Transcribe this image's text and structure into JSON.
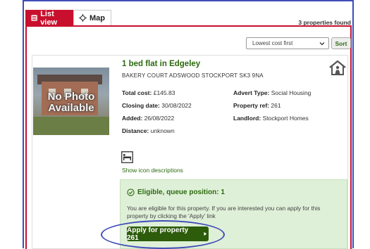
{
  "tabs": {
    "list_label": "List view",
    "map_label": "Map"
  },
  "results": {
    "count": "3 properties found"
  },
  "sort": {
    "selected": "Lowest cost first",
    "button_label": "Sort"
  },
  "property": {
    "title": "1 bed flat in Edgeley",
    "address": "BAKERY COURT ADSWOOD STOCKPORT SK3 9NA",
    "photo_text_line1": "No Photo",
    "photo_text_line2": "Available",
    "fields": {
      "total_cost_label": "Total cost:",
      "total_cost_value": "£145.83",
      "advert_type_label": "Advert Type:",
      "advert_type_value": "Social Housing",
      "closing_date_label": "Closing date:",
      "closing_date_value": "30/08/2022",
      "property_ref_label": "Property ref:",
      "property_ref_value": "261",
      "added_label": "Added:",
      "added_value": "26/08/2022",
      "landlord_label": "Landlord:",
      "landlord_value": "Stockport Homes",
      "distance_label": "Distance:",
      "distance_value": "unknown"
    },
    "icon_descriptions_link": "Show icon descriptions"
  },
  "eligibility": {
    "title": "Eligible, queue position: 1",
    "message": "You are eligible for this property. If you are interested you can apply for this property by clicking the 'Apply' link",
    "apply_label": "Apply for property 261"
  },
  "colors": {
    "brand_red": "#c8102e",
    "green_text": "#2d6a10",
    "apply_button": "#2d5c0a",
    "eligible_bg": "#dff0d8",
    "highlight_blue": "#3f4db8"
  },
  "icons": {
    "list_tab": "list-icon",
    "map_tab": "crosshair-icon",
    "property_type": "house-person-icon",
    "bedroom": "bed-icon",
    "eligible": "check-circle-icon",
    "apply_arrow": "caret-right-icon"
  }
}
